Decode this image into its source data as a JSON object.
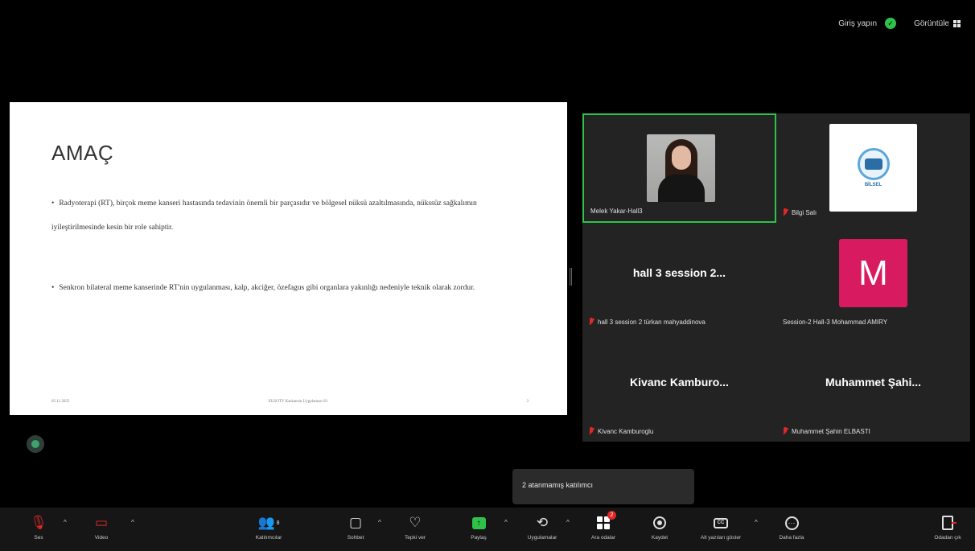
{
  "header": {
    "signin_label": "Giriş yapın",
    "view_label": "Görüntüle"
  },
  "slide": {
    "title": "AMAÇ",
    "bullets": [
      "Radyoterapi (RT), birçok meme kanseri hastasında tedavinin önemli bir parçasıdır ve bölgesel nüksü azaltılmasında, nükssüz sağkalımın iyileştirilmesinde kesin bir role sahiptir.",
      "Senkron bilateral meme kanserinde RT'nin uygulanması, kalp, akciğer, özefagus gibi organlara yakınlığı nedeniyle teknik olarak zordur."
    ],
    "footer_left": "05.11.2025",
    "footer_center": "EUSOTY Kaskansin Uygulaması 03",
    "footer_right": "3"
  },
  "participants": [
    {
      "name": "Melek Yakar-Hall3",
      "muted": false,
      "active": true,
      "type": "photo"
    },
    {
      "name": "Bilgi Salı",
      "muted": true,
      "active": false,
      "type": "logo",
      "logo_text": "BİLSEL"
    },
    {
      "name": "hall 3 session 2  türkan mahyaddinova",
      "display": "hall 3 session 2...",
      "muted": true,
      "active": false,
      "type": "name"
    },
    {
      "name": "Session-2 Hall-3 Mohammad AMIRY",
      "muted": false,
      "active": false,
      "type": "avatar",
      "initial": "M"
    },
    {
      "name": "Kivanc Kamburoglu",
      "display": "Kivanc  Kamburo...",
      "muted": true,
      "active": false,
      "type": "name"
    },
    {
      "name": "Muhammet Şahin ELBASTI",
      "display": "Muhammet  Şahi...",
      "muted": true,
      "active": false,
      "type": "name"
    }
  ],
  "toast": {
    "text": "2 atanmamış katılımcı"
  },
  "toolbar": {
    "audio": "Ses",
    "video": "Video",
    "participants": "Katılımcılar",
    "participants_count": "8",
    "chat": "Sohbet",
    "react": "Tepki ver",
    "share": "Paylaş",
    "apps": "Uygulamalar",
    "breakout": "Ara odalar",
    "breakout_badge": "2",
    "record": "Kaydet",
    "captions": "Alt yazıları göster",
    "more": "Daha fazla",
    "leave": "Odadan çık"
  },
  "colors": {
    "active_border": "#2ec24a",
    "avatar_m": "#d81b60",
    "muted_red": "#e02828",
    "share_green": "#2ec24a"
  },
  "icons": [
    "shield-check-icon",
    "grid-view-icon",
    "mic-off-icon",
    "video-off-icon",
    "participants-icon",
    "chat-icon",
    "heart-icon",
    "share-screen-icon",
    "apps-icon",
    "breakout-rooms-icon",
    "record-icon",
    "captions-icon",
    "more-icon",
    "leave-icon"
  ]
}
